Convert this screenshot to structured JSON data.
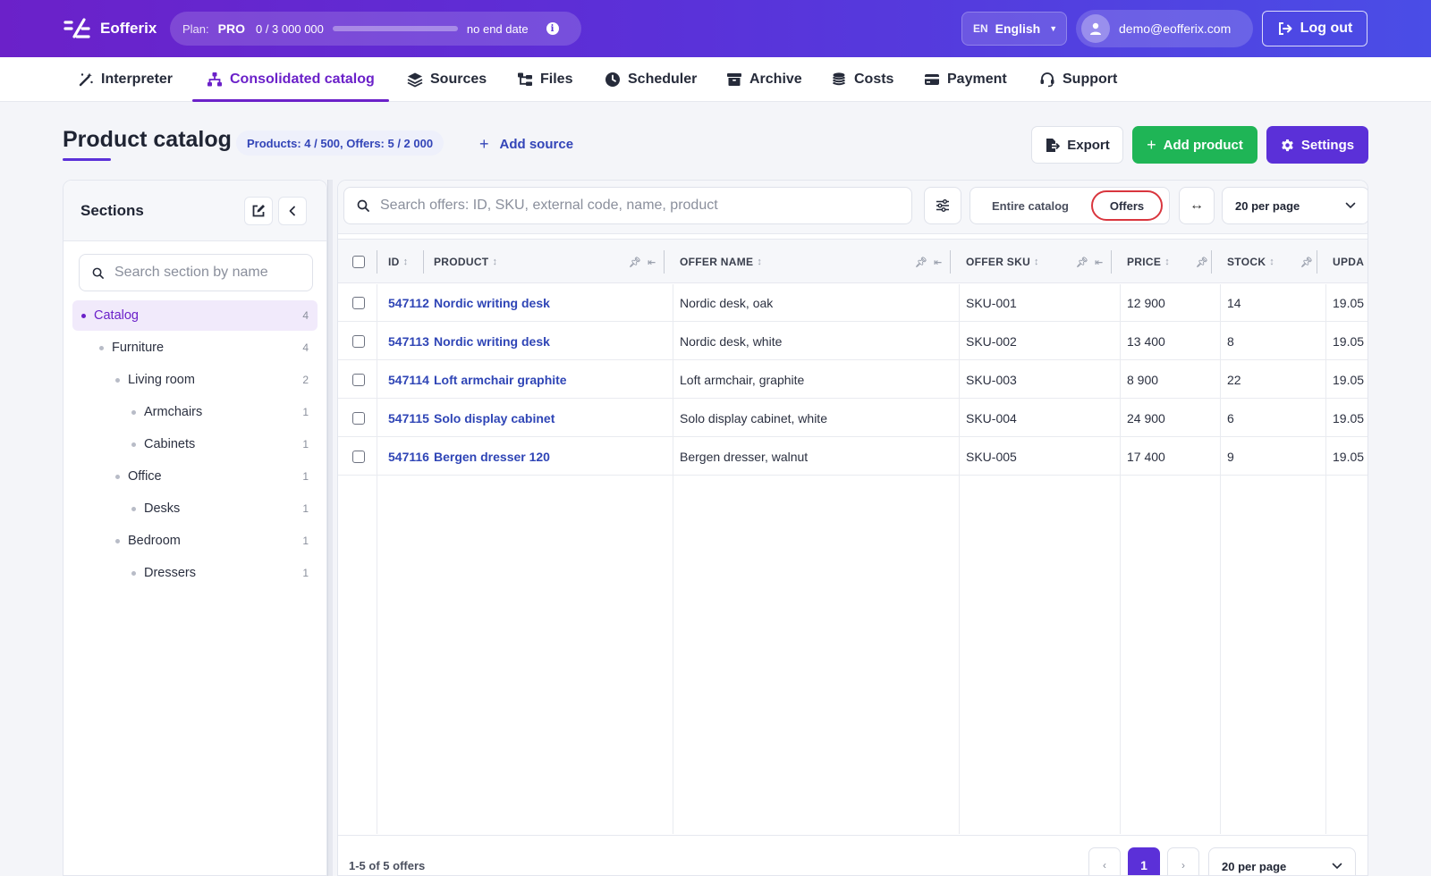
{
  "app": {
    "name": "Eofferix"
  },
  "plan": {
    "label": "Plan:",
    "tier": "PRO",
    "usage": "0 / 3 000 000",
    "progress": 0,
    "expiry": "no end date"
  },
  "language": {
    "code": "EN",
    "label": "English"
  },
  "user": {
    "email": "demo@eofferix.com"
  },
  "logout_label": "Log out",
  "nav": [
    {
      "label": "Interpreter",
      "icon": "wand-icon"
    },
    {
      "label": "Consolidated catalog",
      "icon": "sitemap-icon",
      "active": true
    },
    {
      "label": "Sources",
      "icon": "layers-icon"
    },
    {
      "label": "Files",
      "icon": "folder-tree-icon"
    },
    {
      "label": "Scheduler",
      "icon": "clock-icon"
    },
    {
      "label": "Archive",
      "icon": "archive-icon"
    },
    {
      "label": "Costs",
      "icon": "coins-icon"
    },
    {
      "label": "Payment",
      "icon": "credit-card-icon"
    },
    {
      "label": "Support",
      "icon": "headset-icon"
    }
  ],
  "page": {
    "title": "Product catalog",
    "counts": "Products: 4 / 500, Offers: 5 / 2 000",
    "add_source": "Add source",
    "export": "Export",
    "add_product": "Add product",
    "settings": "Settings"
  },
  "sidebar": {
    "title": "Sections",
    "search_placeholder": "Search section by name",
    "tree": [
      {
        "label": "Catalog",
        "count": "4",
        "level": 0,
        "selected": true
      },
      {
        "label": "Furniture",
        "count": "4",
        "level": 1
      },
      {
        "label": "Living room",
        "count": "2",
        "level": 2
      },
      {
        "label": "Armchairs",
        "count": "1",
        "level": 3
      },
      {
        "label": "Cabinets",
        "count": "1",
        "level": 3
      },
      {
        "label": "Office",
        "count": "1",
        "level": 2
      },
      {
        "label": "Desks",
        "count": "1",
        "level": 3
      },
      {
        "label": "Bedroom",
        "count": "1",
        "level": 2
      },
      {
        "label": "Dressers",
        "count": "1",
        "level": 3
      }
    ]
  },
  "toolbar": {
    "search_placeholder": "Search offers: ID, SKU, external code, name, product",
    "mode_catalog": "Entire catalog",
    "mode_offers": "Offers",
    "per_page": "20 per page"
  },
  "table": {
    "columns": [
      "ID",
      "PRODUCT",
      "OFFER NAME",
      "OFFER SKU",
      "PRICE",
      "STOCK",
      "UPDA"
    ],
    "rows": [
      {
        "id": "547112",
        "product": "Nordic writing desk",
        "offer": "Nordic desk, oak",
        "sku": "SKU-001",
        "price": "12 900",
        "stock": "14",
        "updated": "19.05"
      },
      {
        "id": "547113",
        "product": "Nordic writing desk",
        "offer": "Nordic desk, white",
        "sku": "SKU-002",
        "price": "13 400",
        "stock": "8",
        "updated": "19.05"
      },
      {
        "id": "547114",
        "product": "Loft armchair graphite",
        "offer": "Loft armchair, graphite",
        "sku": "SKU-003",
        "price": "8 900",
        "stock": "22",
        "updated": "19.05"
      },
      {
        "id": "547115",
        "product": "Solo display cabinet",
        "offer": "Solo display cabinet, white",
        "sku": "SKU-004",
        "price": "24 900",
        "stock": "6",
        "updated": "19.05"
      },
      {
        "id": "547116",
        "product": "Bergen dresser 120",
        "offer": "Bergen dresser, walnut",
        "sku": "SKU-005",
        "price": "17 400",
        "stock": "9",
        "updated": "19.05"
      }
    ]
  },
  "footer": {
    "range": "1-5 of 5 offers",
    "prev": "‹",
    "page": "1",
    "next": "›",
    "per_page": "20 per page"
  }
}
